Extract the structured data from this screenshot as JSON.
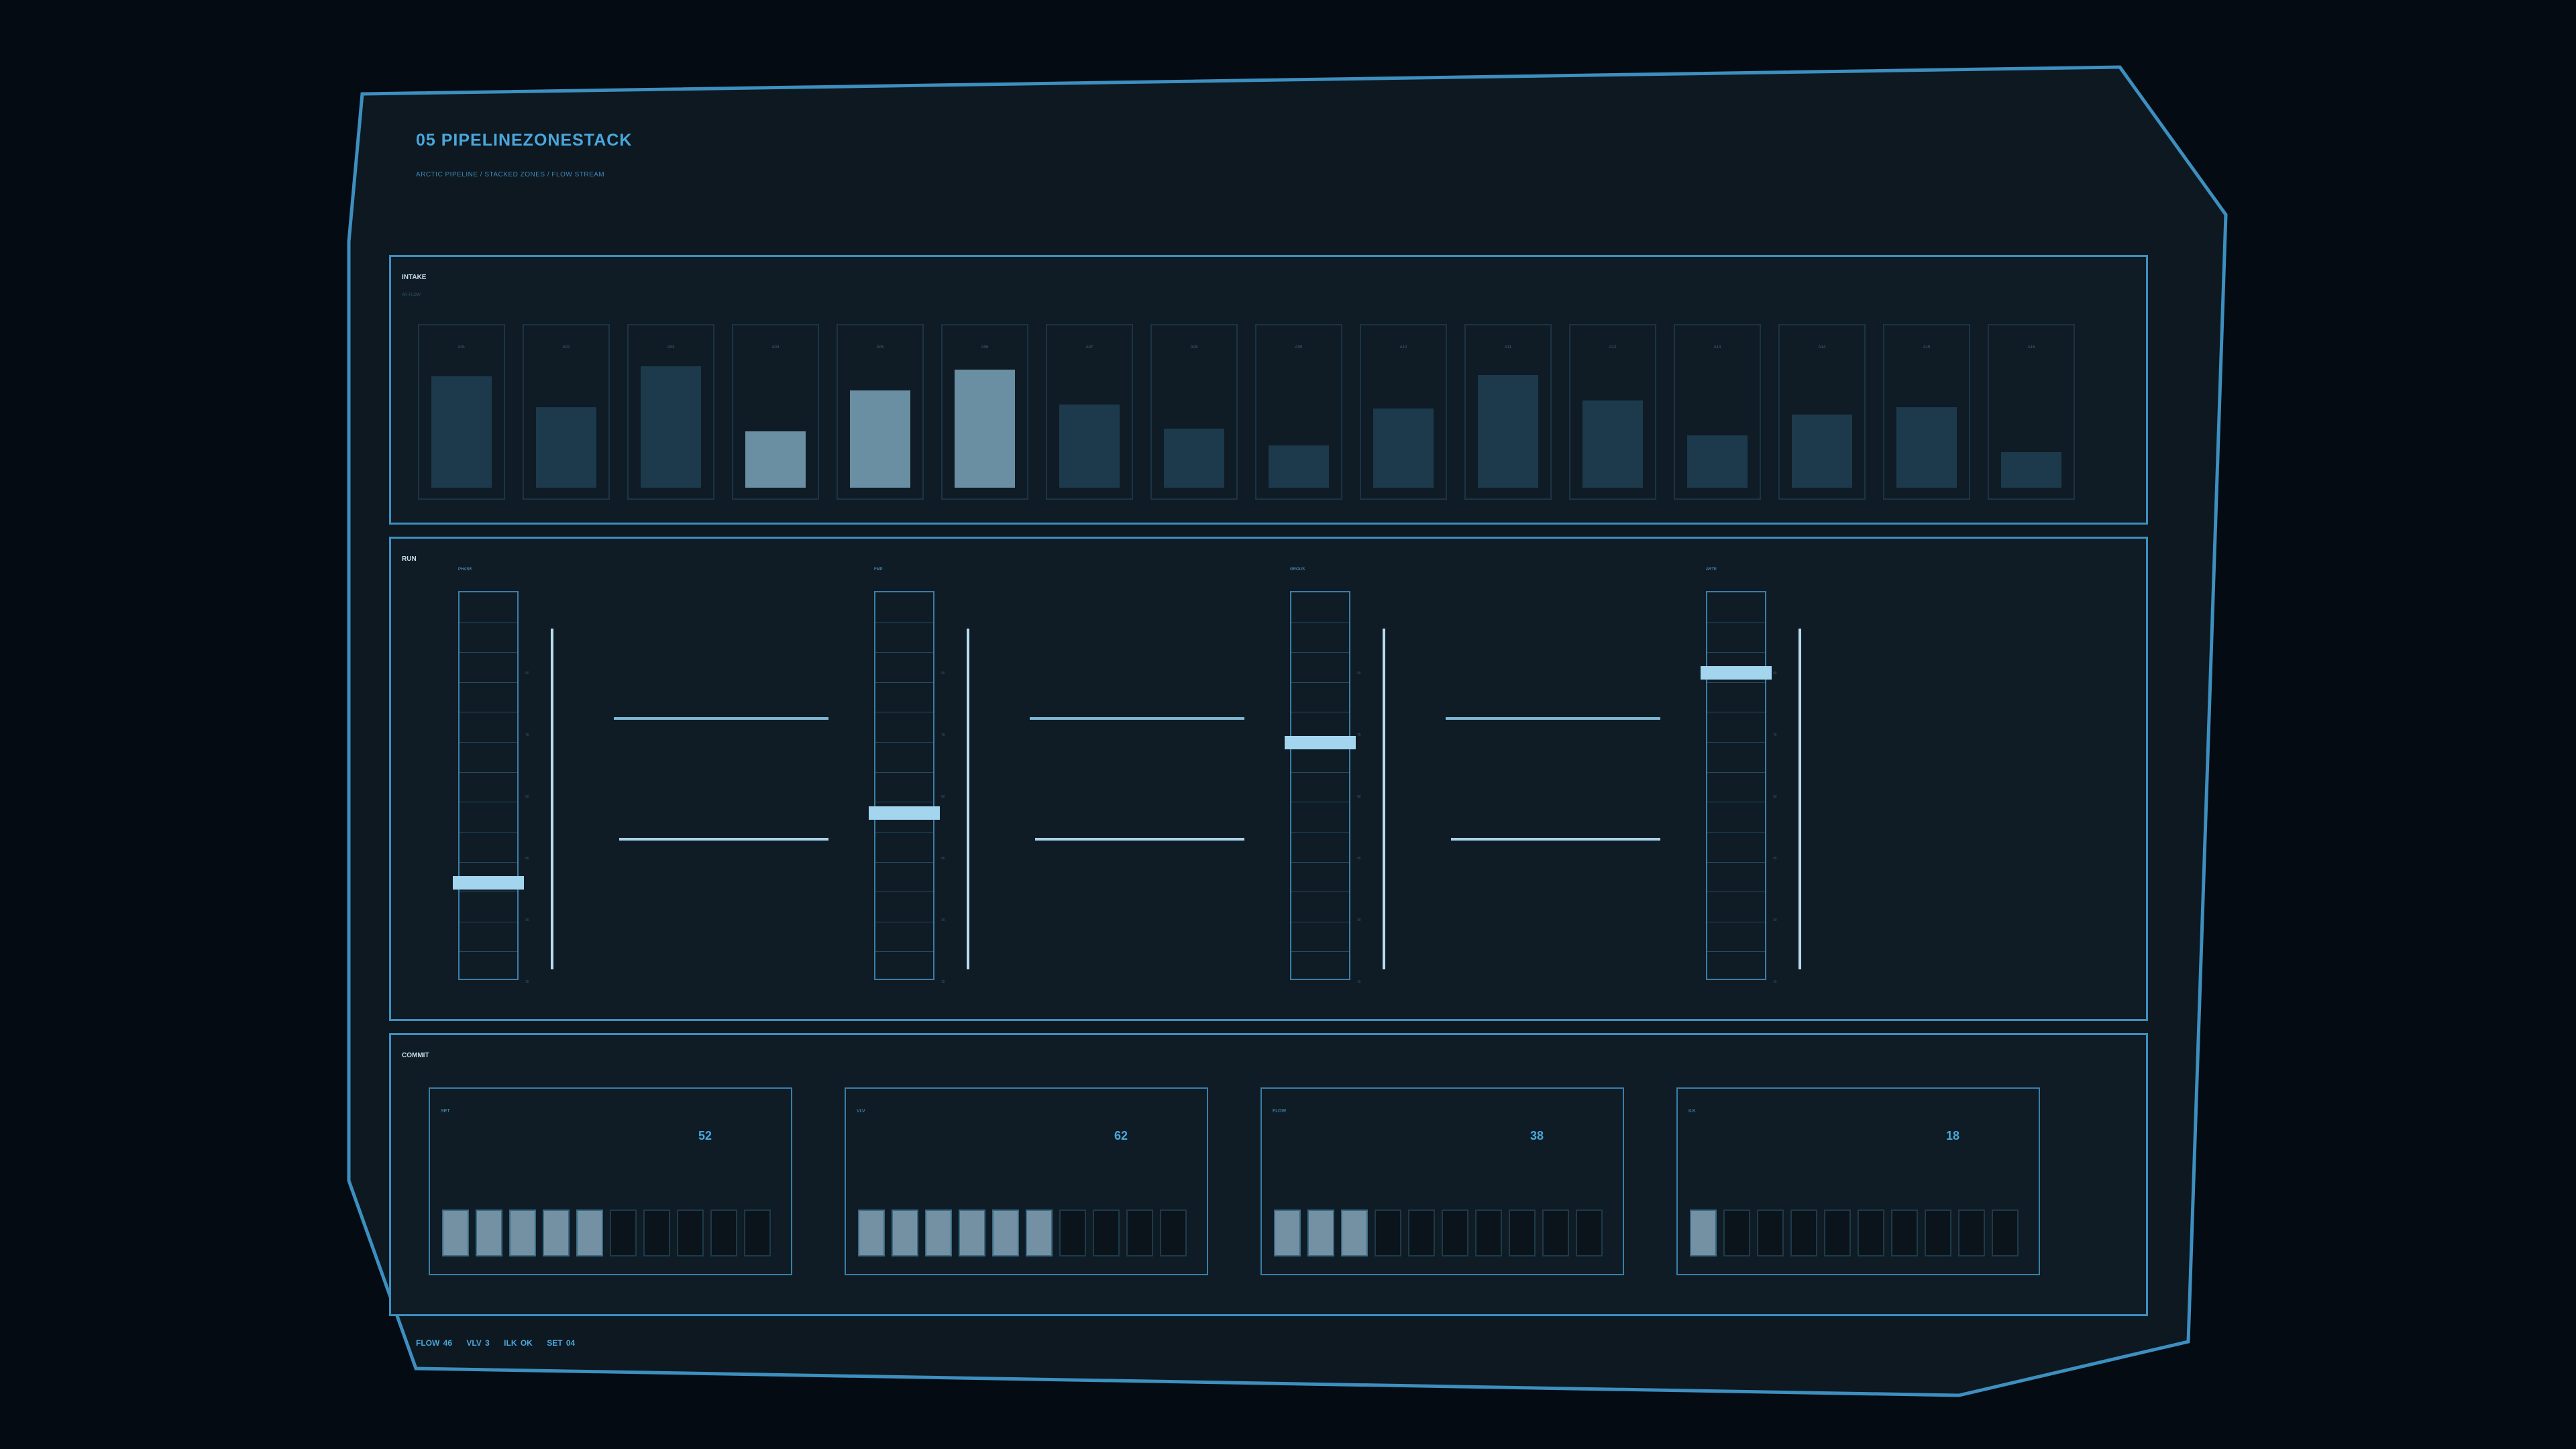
{
  "header": {
    "title": "05  PIPELINEZONESTACK",
    "subtitle": "ARCTIC PIPELINE / STACKED ZONES / FLOW STREAM"
  },
  "colors": {
    "accent": "#4aa7dc",
    "frame": "#3d8fc0",
    "panel_bg": "#0f1c25",
    "page_bg": "#050b12",
    "bar_fill": "#1c3a4c",
    "bar_highlight": "#6a8ea2",
    "knob": "#a3d6ee"
  },
  "intake": {
    "label": "INTAKE",
    "sub": "AR-FLOW",
    "cells": [
      {
        "code": "A01",
        "level": 0.79,
        "highlight": false
      },
      {
        "code": "A02",
        "level": 0.57,
        "highlight": false
      },
      {
        "code": "A03",
        "level": 0.86,
        "highlight": false
      },
      {
        "code": "A04",
        "level": 0.4,
        "highlight": true
      },
      {
        "code": "A05",
        "level": 0.69,
        "highlight": true
      },
      {
        "code": "A06",
        "level": 0.84,
        "highlight": true
      },
      {
        "code": "A07",
        "level": 0.59,
        "highlight": false
      },
      {
        "code": "A08",
        "level": 0.42,
        "highlight": false
      },
      {
        "code": "A09",
        "level": 0.3,
        "highlight": false
      },
      {
        "code": "A10",
        "level": 0.56,
        "highlight": false
      },
      {
        "code": "A11",
        "level": 0.8,
        "highlight": false
      },
      {
        "code": "A12",
        "level": 0.62,
        "highlight": false
      },
      {
        "code": "A13",
        "level": 0.37,
        "highlight": false
      },
      {
        "code": "A14",
        "level": 0.52,
        "highlight": false
      },
      {
        "code": "A15",
        "level": 0.57,
        "highlight": false
      },
      {
        "code": "A16",
        "level": 0.25,
        "highlight": false
      }
    ]
  },
  "run": {
    "label": "RUN",
    "ticks": [
      "90",
      "75",
      "60",
      "45",
      "30",
      "15",
      "0"
    ],
    "channels": [
      {
        "code": "PHASE",
        "value": 0.25
      },
      {
        "code": "FMP",
        "value": 0.43
      },
      {
        "code": "GROUS",
        "value": 0.61
      },
      {
        "code": "ARTE",
        "value": 0.79
      }
    ]
  },
  "commit": {
    "label": "COMMIT",
    "panels": [
      {
        "code": "SET",
        "value": "52",
        "lit": 5
      },
      {
        "code": "VLV",
        "value": "62",
        "lit": 6
      },
      {
        "code": "FLOW",
        "value": "38",
        "lit": 3
      },
      {
        "code": "ILK",
        "value": "18",
        "lit": 1
      }
    ],
    "segments_per_panel": 10
  },
  "status": {
    "flow": "FLOW 46",
    "vlv": "VLV 3",
    "ilk": "ILK OK",
    "set": "SET 04"
  }
}
